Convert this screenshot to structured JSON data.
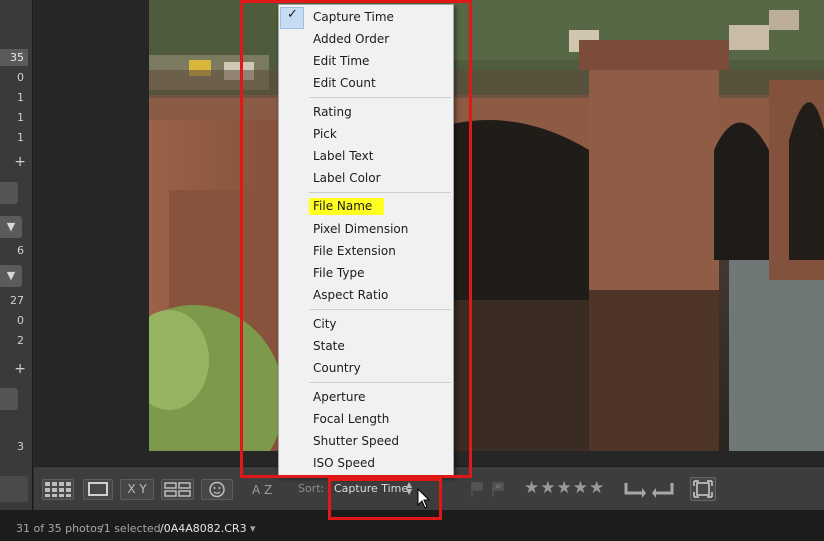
{
  "left_panel": {
    "counts": [
      "35",
      "0",
      "1",
      "1",
      "1",
      "6",
      "27",
      "0",
      "2",
      "3"
    ],
    "plus_glyph": "+",
    "dropdown_glyph": "▼"
  },
  "sort_menu": {
    "groups": [
      [
        "Capture Time",
        "Added Order",
        "Edit Time",
        "Edit Count"
      ],
      [
        "Rating",
        "Pick",
        "Label Text",
        "Label Color"
      ],
      [
        "File Name",
        "Pixel Dimension",
        "File Extension",
        "File Type",
        "Aspect Ratio"
      ],
      [
        "City",
        "State",
        "Country"
      ],
      [
        "Aperture",
        "Focal Length",
        "Shutter Speed",
        "ISO Speed"
      ]
    ],
    "checked_item": "Capture Time",
    "highlighted_item": "File Name"
  },
  "toolbar": {
    "grid_view_icon": "grid-icon",
    "loupe_view_icon": "loupe-icon",
    "compare_label": "X Y",
    "survey_icon": "survey-icon",
    "people_icon": "people-icon",
    "sort_direction_label": "A Z",
    "sort_label": "Sort:",
    "sort_value": "Capture Time",
    "stars": "★★★★★",
    "rotate_left_icon": "rotate-left-icon",
    "rotate_right_icon": "rotate-right-icon"
  },
  "status_bar": {
    "summary": "31 of 35 photos",
    "selected": "/1 selected",
    "filename": "/0A4A8082.CR3",
    "dropdown_glyph": "▾"
  },
  "colors": {
    "annotation_red": "#e01818",
    "highlight_yellow": "#ffff22",
    "menu_background": "#f1f1f1"
  }
}
